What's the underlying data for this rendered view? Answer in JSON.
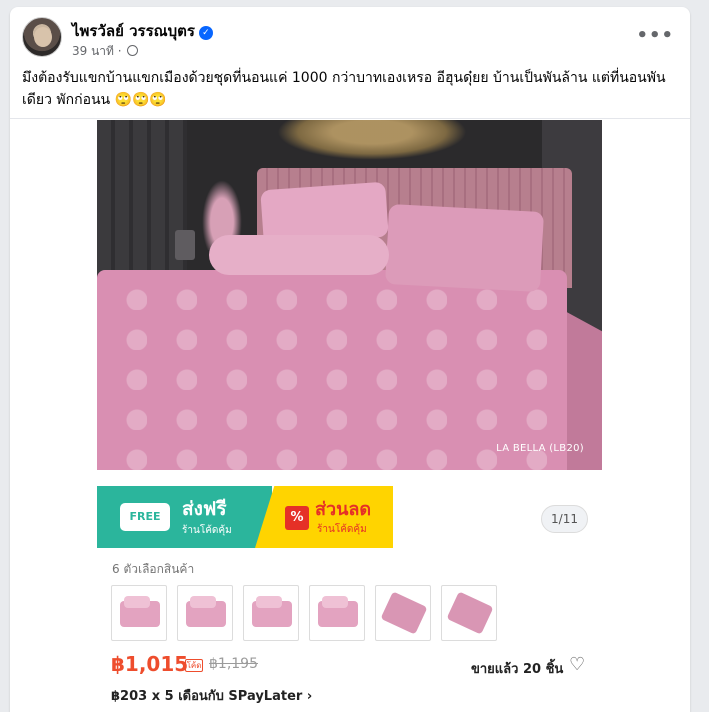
{
  "post": {
    "author": "ไพรวัลย์ วรรณบุตร",
    "verified_icon": "verified-badge-icon",
    "time": "39 นาที",
    "separator": "·",
    "privacy_icon": "globe-icon",
    "more_label": "•••",
    "text": "มึงต้องรับแขกบ้านแขกเมืองด้วยชุดที่นอนแค่ 1000 กว่าบาทเองเหรอ อีฮุนดุ๋ยย บ้านเป็นพันล้าน แต่ที่นอนพันเดียว พักก่อนน 🙄🙄🙄"
  },
  "photo": {
    "caption": "LA BELLA (LB20)"
  },
  "banner": {
    "free_icon_text": "FREE",
    "free_title": "ส่งฟรี",
    "free_sub": "ร้านโค้ดคุ้ม",
    "discount_icon_text": "%",
    "discount_title": "ส่วนลด",
    "discount_sub": "ร้านโค้ดคุ้ม",
    "pager": "1/11"
  },
  "product": {
    "options_label": "6 ตัวเลือกสินค้า",
    "price": "฿1,015",
    "price_badge": "โค้ด",
    "old_price": "฿1,195",
    "sold": "ขายแล้ว 20 ชิ้น",
    "heart_icon": "♡",
    "installment": "฿203 x 5 เดือนกับ SPayLater ›"
  },
  "colors": {
    "accent": "#0866ff",
    "price": "#ee4d2d",
    "free_green": "#2bb59c",
    "discount_yellow": "#ffd400"
  }
}
